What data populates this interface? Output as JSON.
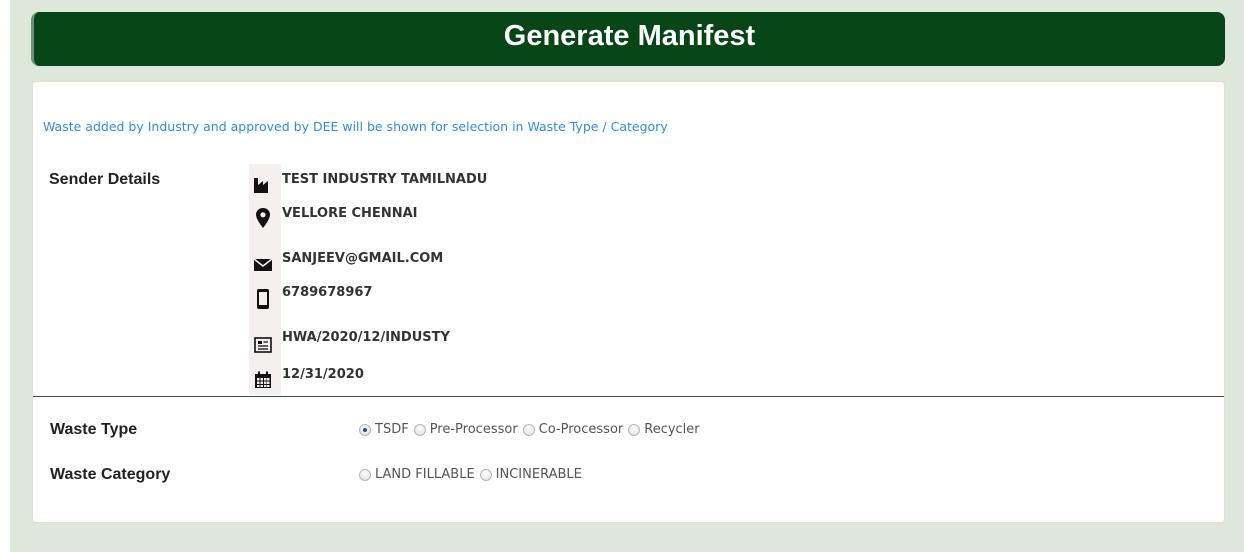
{
  "header": {
    "title": "Generate Manifest"
  },
  "note": "Waste added by Industry and approved by DEE will be shown for selection in Waste Type / Category",
  "sender": {
    "label": "Sender Details",
    "industry": "TEST INDUSTRY TAMILNADU",
    "address": "VELLORE CHENNAI",
    "email": "SANJEEV@GMAIL.COM",
    "phone": "6789678967",
    "authorization": "HWA/2020/12/INDUSTY",
    "date": "12/31/2020"
  },
  "waste_type": {
    "label": "Waste Type",
    "options": [
      "TSDF",
      "Pre-Processor",
      "Co-Processor",
      "Recycler"
    ],
    "selected": "TSDF"
  },
  "waste_category": {
    "label": "Waste Category",
    "options": [
      "LAND FILLABLE",
      "INCINERABLE"
    ],
    "selected": ""
  },
  "colors": {
    "header_bg": "#064516",
    "page_bg": "#dde8da",
    "note_text": "#2f8ee0",
    "divider": "#2f5a34"
  },
  "icons": [
    "factory-icon",
    "map-marker-icon",
    "envelope-icon",
    "mobile-icon",
    "certificate-icon",
    "calendar-icon"
  ]
}
